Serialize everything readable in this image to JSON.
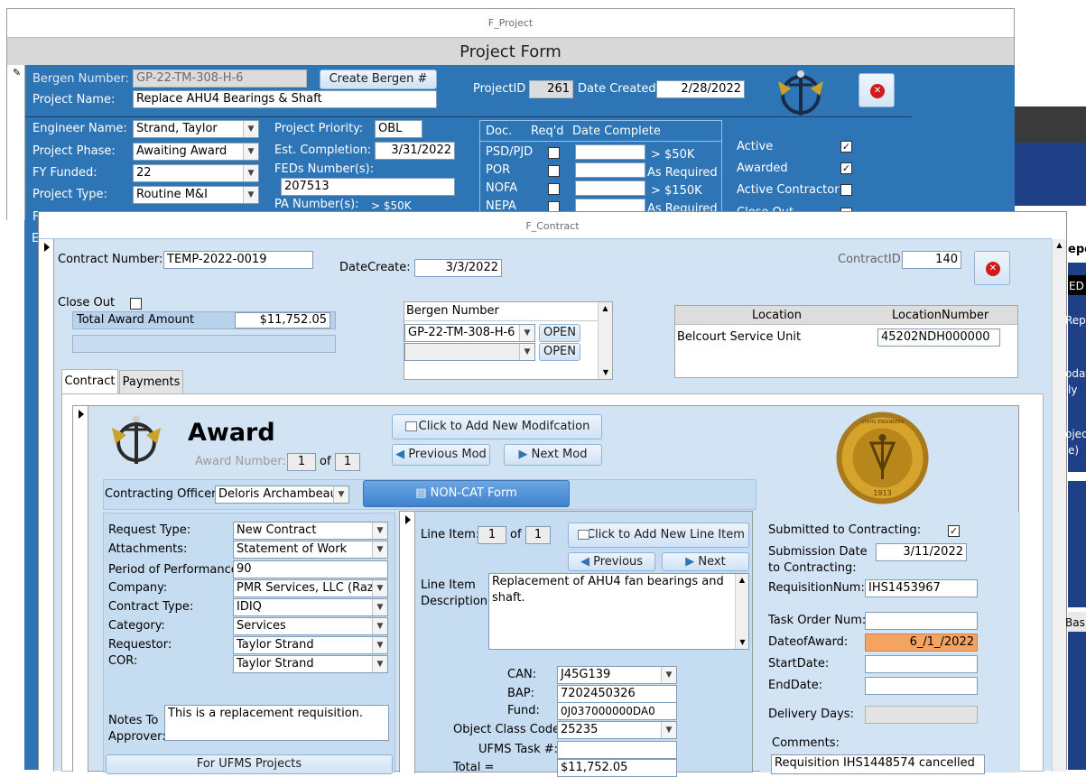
{
  "project_window": {
    "title": "F_Project",
    "header": "Project Form",
    "bergen_number_label": "Bergen Number:",
    "bergen_number": "GP-22-TM-308-H-6",
    "create_bergen_button": "Create Bergen #",
    "project_name_label": "Project Name:",
    "project_name": "Replace AHU4 Bearings & Shaft",
    "project_id_label": "ProjectID",
    "project_id": "261",
    "date_created_label": "Date Created:",
    "date_created": "2/28/2022",
    "engineer_name_label": "Engineer Name:",
    "engineer_name": "Strand,  Taylor",
    "project_phase_label": "Project Phase:",
    "project_phase": "Awaiting Award",
    "fy_funded_label": "FY Funded:",
    "fy_funded": "22",
    "project_type_label": "Project Type:",
    "project_type": "Routine M&I",
    "project_priority_label": "Project Priority:",
    "project_priority": "OBL",
    "est_completion_label": "Est. Completion:",
    "est_completion": "3/31/2022",
    "feds_number_label": "FEDs Number(s):",
    "feds_number": "207513",
    "pa_number_label": "PA Number(s):",
    "pa_note": "> $50K",
    "doc_table": {
      "headers": [
        "Doc.",
        "Req'd",
        "Date Complete"
      ],
      "rows": [
        {
          "doc": "PSD/PJD",
          "note": "> $50K"
        },
        {
          "doc": "POR",
          "note": "As Required"
        },
        {
          "doc": "NOFA",
          "note": "> $150K"
        },
        {
          "doc": "NEPA",
          "note": "As Required"
        }
      ]
    },
    "status": [
      {
        "label": "Active",
        "checked": true
      },
      {
        "label": "Awarded",
        "checked": true
      },
      {
        "label": "Active Contractor",
        "checked": false
      },
      {
        "label": "Close Out",
        "checked": false
      }
    ],
    "left_partial_labels": [
      "F",
      "E"
    ]
  },
  "contract_window": {
    "title": "F_Contract",
    "contract_number_label": "Contract Number:",
    "contract_number": "TEMP-2022-0019",
    "date_create_label": "DateCreate:",
    "date_create": "3/3/2022",
    "contract_id_label": "ContractID",
    "contract_id": "140",
    "close_out_label": "Close Out",
    "total_award_label": "Total Award Amount",
    "total_award": "$11,752.05",
    "bergen_header": "Bergen Number",
    "bergen_rows": [
      {
        "value": "GP-22-TM-308-H-6",
        "button": "OPEN"
      },
      {
        "value": "",
        "button": "OPEN"
      }
    ],
    "location_headers": [
      "Location",
      "LocationNumber"
    ],
    "location_rows": [
      {
        "location": "Belcourt Service Unit",
        "number": "45202NDH000000"
      }
    ],
    "tabs": [
      "Contract",
      "Payments"
    ],
    "award": {
      "title": "Award",
      "award_number_label": "Award Number:",
      "award_number": "1",
      "of_label": "of",
      "award_total": "1",
      "add_mod_button": "Click to Add New Modifcation",
      "prev_mod_button": "Previous Mod",
      "next_mod_button": "Next Mod",
      "contracting_officer_label": "Contracting Officer:",
      "contracting_officer": "Deloris Archambeau",
      "noncat_button": "NON-CAT Form",
      "fields": [
        {
          "label": "Request Type:",
          "value": "New Contract",
          "combo": true
        },
        {
          "label": "Attachments:",
          "value": "Statement of Work",
          "combo": true
        },
        {
          "label": "Period of Performance",
          "value": "90",
          "combo": false
        },
        {
          "label": "Company:",
          "value": "PMR Services, LLC  (Razor",
          "combo": true
        },
        {
          "label": "Contract Type:",
          "value": "IDIQ",
          "combo": true
        },
        {
          "label": "Category:",
          "value": "Services",
          "combo": true
        },
        {
          "label": "Requestor:",
          "value": "Taylor Strand",
          "combo": true
        },
        {
          "label": "COR:",
          "value": "Taylor Strand",
          "combo": true
        }
      ],
      "notes_label_1": "Notes To",
      "notes_label_2": "Approver:",
      "notes": "This is a replacement requisition.",
      "ufms_button": "For UFMS Projects",
      "line_item": {
        "label": "Line Item:",
        "number": "1",
        "of_label": "of",
        "total": "1",
        "add_button": "Click to Add New Line Item",
        "prev_button": "Previous",
        "next_button": "Next",
        "desc_label_1": "Line Item",
        "desc_label_2": "Description",
        "description": "Replacement of AHU4 fan bearings and shaft.",
        "can_label": "CAN:",
        "can": "J45G139",
        "bap_label": "BAP:",
        "bap": "7202450326",
        "fund_label": "Fund:",
        "fund": "0J037000000DA0",
        "object_class_label": "Object Class Code",
        "object_class": "25235",
        "ufms_task_label": "UFMS Task #:",
        "ufms_task": "",
        "total_label": "Total  =",
        "total_amount": "$11,752.05"
      },
      "seal_text": "USPHS ENGINEERS",
      "seal_year": "1913",
      "submitted_label": "Submitted to Contracting:",
      "submitted": true,
      "submission_date_label_1": "Submission Date",
      "submission_date_label_2": "to Contracting:",
      "submission_date": "3/11/2022",
      "requisition_label": "RequisitionNum:",
      "requisition": "IHS1453967",
      "task_order_label": "Task Order Num:",
      "task_order": "",
      "date_of_award_label": "DateofAward:",
      "date_of_award": "6_/1_/2022",
      "start_date_label": "StartDate:",
      "start_date": "",
      "end_date_label": "EndDate:",
      "end_date": "",
      "delivery_days_label": "Delivery Days:",
      "delivery_days": "",
      "comments_label": "Comments:",
      "comments": "Requisition IHS1448574 cancelled"
    }
  },
  "background_fragments": [
    "epo",
    "ED",
    "Rep",
    "odat",
    "ly",
    "ojec",
    "e)",
    "Bas"
  ],
  "colors": {
    "project_blue": "#2e75b6",
    "contract_light": "#d2e3f3",
    "award_panel": "#c6dcf0",
    "date_of_award_highlight": "#f4a460"
  }
}
